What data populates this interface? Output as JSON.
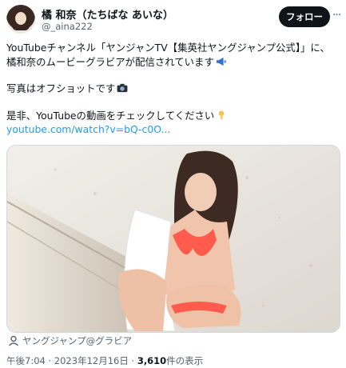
{
  "author": {
    "display_name": "橘 和奈（たちばな あいな）",
    "handle": "@_aina222"
  },
  "follow_button": "フォロー",
  "more_button": "···",
  "tweet": {
    "line1": "YouTubeチャンネル「ヤンジャンTV【集英社ヤングジャンプ公式】」に、",
    "line2": "橘和奈のムービーグラビアが配信されています",
    "line3": "写真はオフショットです",
    "line4": "是非、YouTubeの動画をチェックしてください",
    "link": "youtube.com/watch?v=bQ-c0O..."
  },
  "media_tag": "ヤングジャンプ@グラビア",
  "meta": {
    "time": "午後7:04",
    "date": "2023年12月16日",
    "views_count": "3,610",
    "views_label": "件の表示"
  },
  "icons": [
    "avatar",
    "megaphone-emoji",
    "camera-emoji",
    "pointing-down-emoji",
    "person-tag-icon"
  ],
  "colors": {
    "link": "#1d9bf0",
    "muted": "#536471",
    "follow_bg": "#0f1419"
  }
}
